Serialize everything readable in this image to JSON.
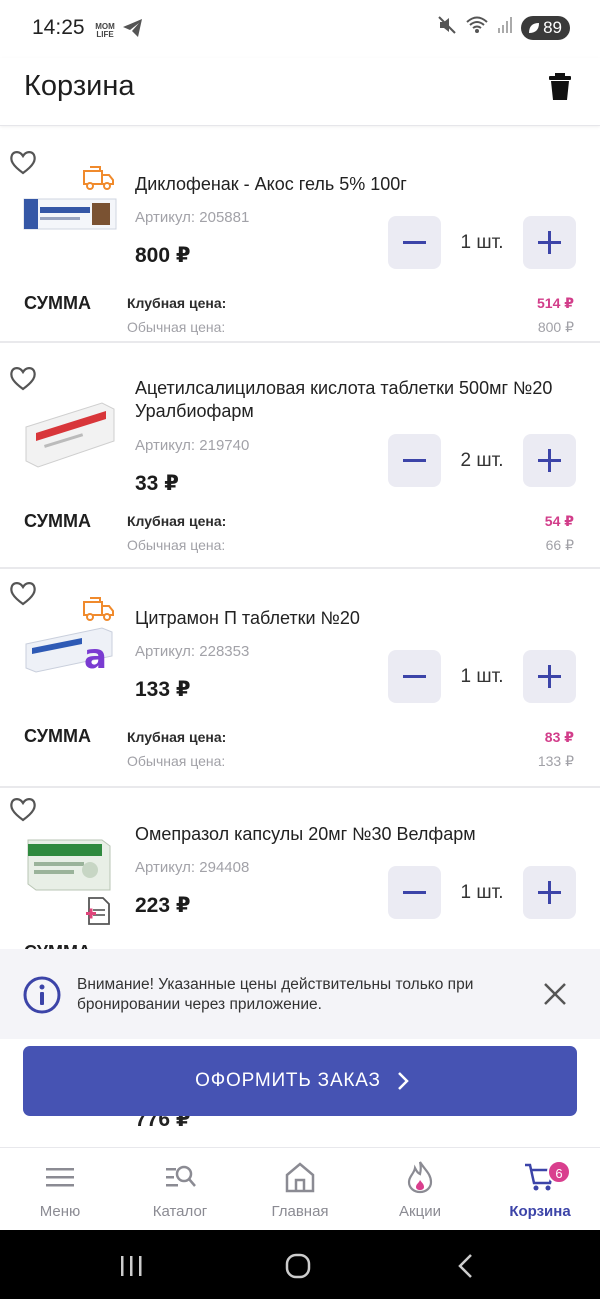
{
  "status_bar": {
    "time": "14:25",
    "app_badge": "MOM LIFE",
    "battery": "89"
  },
  "header": {
    "title": "Корзина"
  },
  "labels": {
    "sum": "СУММА",
    "club_price": "Клубная цена:",
    "regular_price": "Обычная цена:"
  },
  "items": [
    {
      "name": "Диклофенак - Акос гель 5% 100г",
      "sku": "Артикул: 205881",
      "price": "800 ₽",
      "quantity": "1 шт.",
      "club_price": "514 ₽",
      "regular_price": "800 ₽",
      "badge": "delivery-truck-icon"
    },
    {
      "name": "Ацетилсалициловая кислота таблетки 500мг №20 Уралбиофарм",
      "sku": "Артикул: 219740",
      "price": "33 ₽",
      "quantity": "2 шт.",
      "club_price": "54 ₽",
      "regular_price": "66 ₽",
      "badge": ""
    },
    {
      "name": "Цитрамон П таблетки №20",
      "sku": "Артикул: 228353",
      "price": "133 ₽",
      "quantity": "1 шт.",
      "club_price": "83 ₽",
      "regular_price": "133 ₽",
      "badge": "delivery-truck-icon"
    },
    {
      "name": "Омепразол капсулы 20мг №30 Велфарм",
      "sku": "Артикул: 294408",
      "price": "223 ₽",
      "quantity": "1 шт.",
      "club_price": "",
      "regular_price": "",
      "badge": "prescription-icon"
    }
  ],
  "peek_item": {
    "price": "776 ₽"
  },
  "notice": {
    "text": "Внимание! Указанные цены действительны только при бронировании через приложение."
  },
  "order_button": {
    "label": "ОФОРМИТЬ ЗАКАЗ"
  },
  "bottom_nav": {
    "items": [
      {
        "label": "Меню",
        "icon": "menu-icon"
      },
      {
        "label": "Каталог",
        "icon": "catalog-search-icon"
      },
      {
        "label": "Главная",
        "icon": "home-icon"
      },
      {
        "label": "Акции",
        "icon": "flame-icon"
      },
      {
        "label": "Корзина",
        "icon": "cart-icon"
      }
    ],
    "cart_count": "6"
  },
  "colors": {
    "brand": "#4653b3",
    "club_price": "#d23d8a",
    "control_bg": "#ebebf3"
  }
}
